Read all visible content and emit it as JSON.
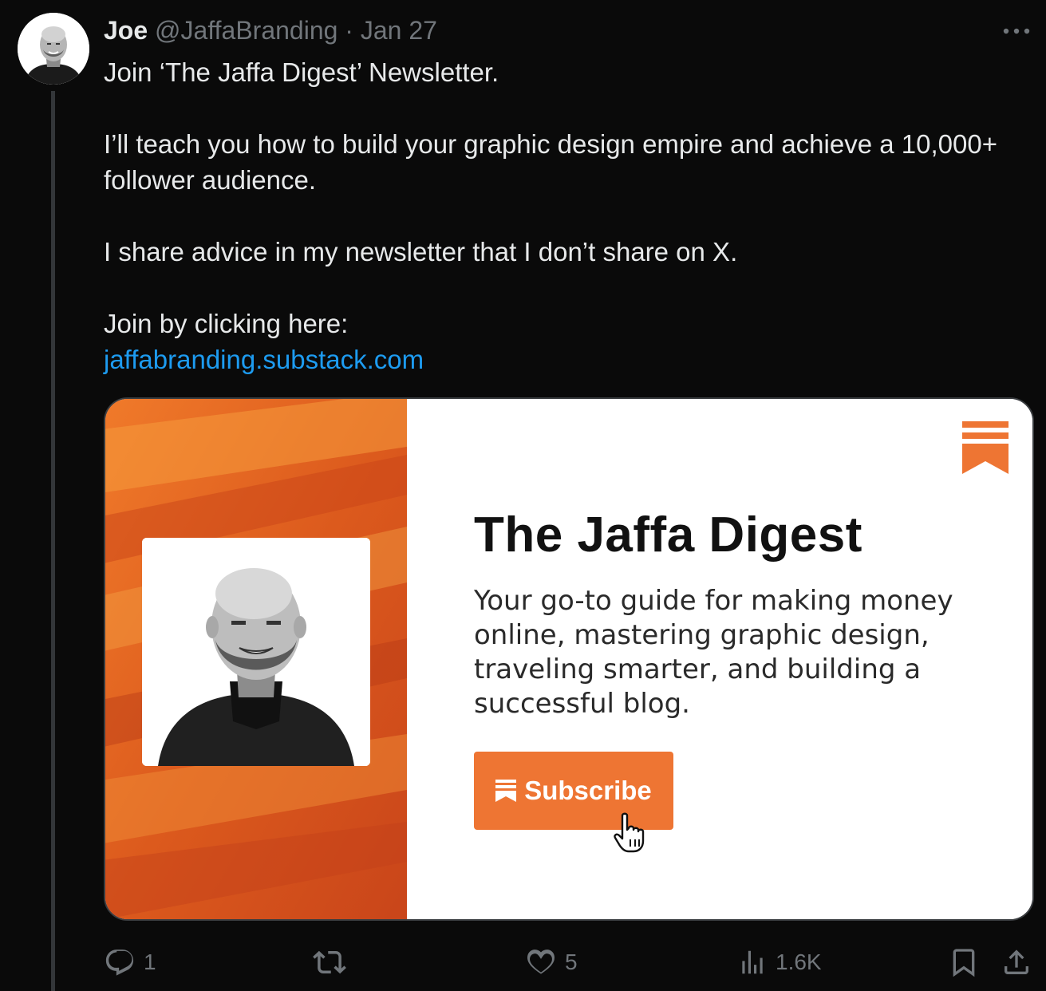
{
  "tweet": {
    "author_name": "Joe",
    "handle": "@JaffaBranding",
    "separator": "·",
    "date": "Jan 27",
    "paragraphs": [
      "Join ‘The Jaffa Digest’ Newsletter.",
      "I’ll teach you how to build your graphic design empire and achieve a 10,000+ follower audience.",
      "I share advice in my newsletter that I don’t share on X.",
      "Join by clicking here:"
    ],
    "link": "jaffabranding.substack.com"
  },
  "card": {
    "title": "The Jaffa Digest",
    "description": "Your go-to guide for making money online, mastering graphic design, traveling smarter, and building a successful blog.",
    "button_label": "Subscribe",
    "accent_color": "#ee7533"
  },
  "actions": {
    "replies": "1",
    "reposts": "",
    "likes": "5",
    "views": "1.6K"
  },
  "icons": [
    "more-icon",
    "reply-icon",
    "repost-icon",
    "like-icon",
    "views-icon",
    "bookmark-icon",
    "share-icon",
    "substack-logo-icon",
    "cursor-icon"
  ]
}
